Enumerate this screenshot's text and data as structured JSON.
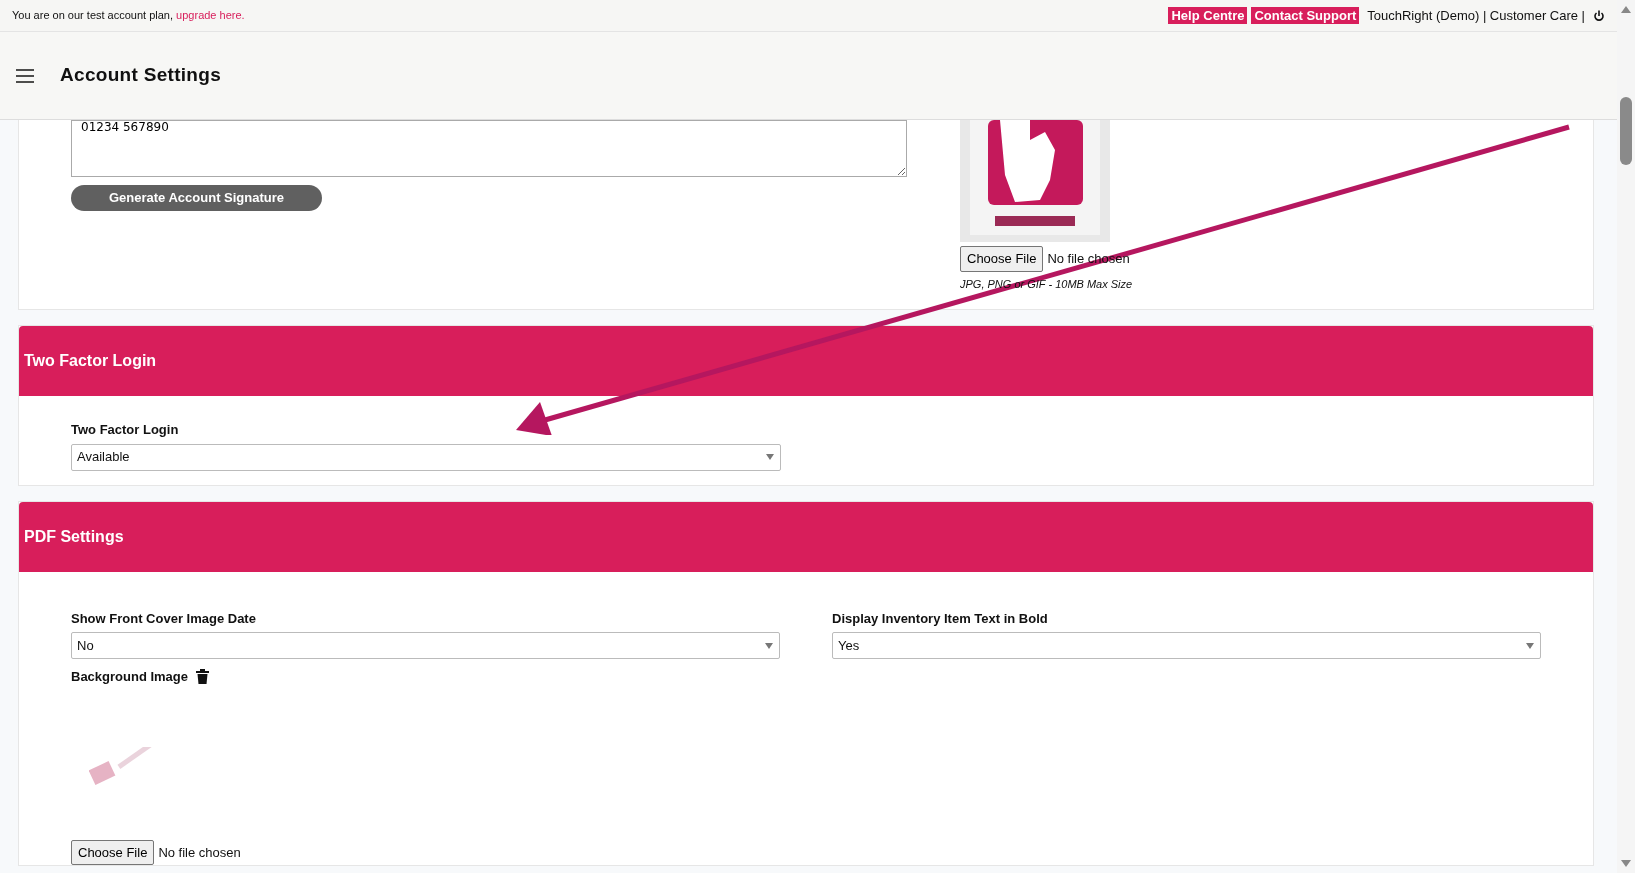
{
  "top_bar": {
    "notice": "You are on our test account plan,",
    "link": "upgrade here.",
    "buttons": [
      "Help Centre",
      "Contact Support"
    ],
    "user": "TouchRight (Demo) | Customer Care |"
  },
  "header": {
    "title": "Account Settings"
  },
  "signature": {
    "value": "01234 567890",
    "button": "Generate Account Signature"
  },
  "logo_upload": {
    "button": "Choose File",
    "status": "No file chosen",
    "hint": "JPG, PNG or GIF - 10MB Max Size"
  },
  "sections": [
    {
      "title": "Two Factor Login",
      "fields": [
        {
          "label": "Two Factor Login",
          "value": "Available"
        }
      ]
    },
    {
      "title": "PDF Settings",
      "fields": [
        {
          "label": "Show Front Cover Image Date",
          "value": "No"
        },
        {
          "label": "Display Inventory Item Text in Bold",
          "value": "Yes"
        }
      ],
      "background_image": {
        "label": "Background Image",
        "button": "Choose File",
        "status": "No file chosen"
      }
    }
  ]
}
